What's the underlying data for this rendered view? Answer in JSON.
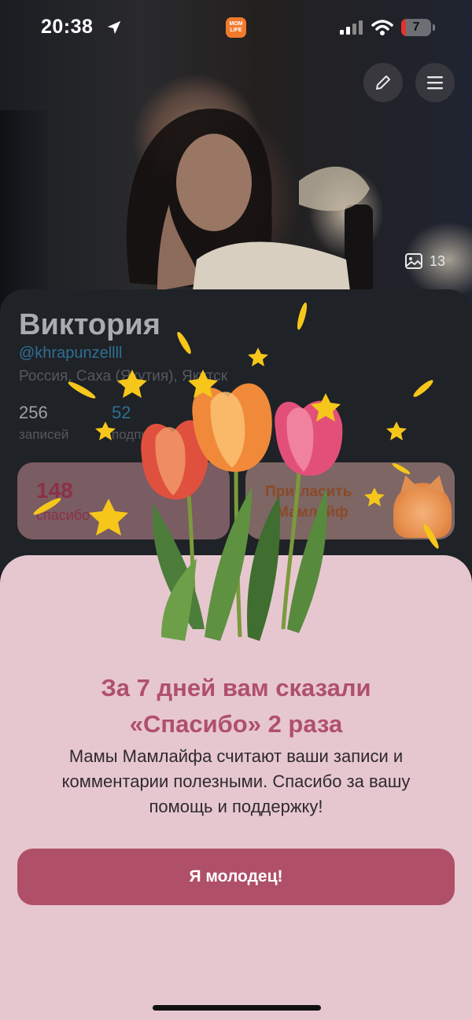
{
  "status_bar": {
    "time": "20:38",
    "app_badge": "MOM LIFE",
    "battery_level": "7",
    "icons": [
      "location-arrow-icon",
      "signal-icon",
      "wifi-icon",
      "battery-icon"
    ]
  },
  "header_actions": {
    "edit_icon": "pencil-icon",
    "menu_icon": "hamburger-menu-icon",
    "photo_count": "13"
  },
  "profile": {
    "name": "Виктория",
    "handle": "@khrapunzellll",
    "location": "Россия, Саха (Якутия), Якутск",
    "stats": [
      {
        "value": "256",
        "label": "записей"
      },
      {
        "value": "52",
        "label": "подписок"
      }
    ],
    "thanks_tile": {
      "value": "148",
      "label": "спасибо"
    },
    "invite_tile": {
      "line1": "Пригласить",
      "line2": "Мамлайф"
    }
  },
  "popup": {
    "title_line1": "За 7 дней вам сказали",
    "title_line2": "«Спасибо» 2 раза",
    "text_line1": "Мамы Мамлайфа считают ваши записи и",
    "text_line2": "комментарии полезными. Спасибо за вашу",
    "text_line3": "помощь и поддержку!",
    "button_label": "Я молодец!"
  },
  "colors": {
    "sheet_bg": "#e6c7d0",
    "title": "#b0506b",
    "button": "#b04f68",
    "card_bg": "#1f2226",
    "star": "#f6c61b"
  }
}
